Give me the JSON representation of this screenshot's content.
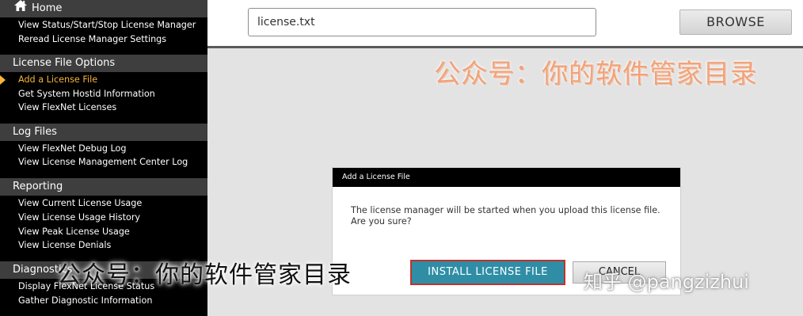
{
  "sidebar": {
    "home_label": "Home",
    "home_items": [
      "View Status/Start/Stop License Manager",
      "Reread License Manager Settings"
    ],
    "sections": [
      {
        "title": "License File Options",
        "items": [
          "Add a License File",
          "Get System Hostid Information",
          "View FlexNet Licenses"
        ]
      },
      {
        "title": "Log Files",
        "items": [
          "View FlexNet Debug Log",
          "View License Management Center Log"
        ]
      },
      {
        "title": "Reporting",
        "items": [
          "View Current License Usage",
          "View License Usage History",
          "View Peak License Usage",
          "View License Denials"
        ]
      },
      {
        "title": "Diagnostics",
        "items": [
          "Display FlexNet License Status",
          "Gather Diagnostic Information"
        ]
      }
    ],
    "active_item": "Add a License File"
  },
  "upload": {
    "file_value": "license.txt",
    "browse_label": "BROWSE"
  },
  "dialog": {
    "title": "Add a License File",
    "message": "The license manager will be started when you upload this license file. Are you sure?",
    "install_label": "INSTALL LICENSE FILE",
    "cancel_label": "CANCEL"
  },
  "watermarks": {
    "orange": "公众号：你的软件管家目录",
    "black": "公众号：你的软件管家目录",
    "zhihu": "知乎 @pangzizhui"
  },
  "colors": {
    "sidebar_bg": "#000000",
    "section_header_bg": "#3e3e3e",
    "active_item": "#f6b535",
    "install_button": "#2f8ea6",
    "install_button_border": "#c2332c"
  }
}
